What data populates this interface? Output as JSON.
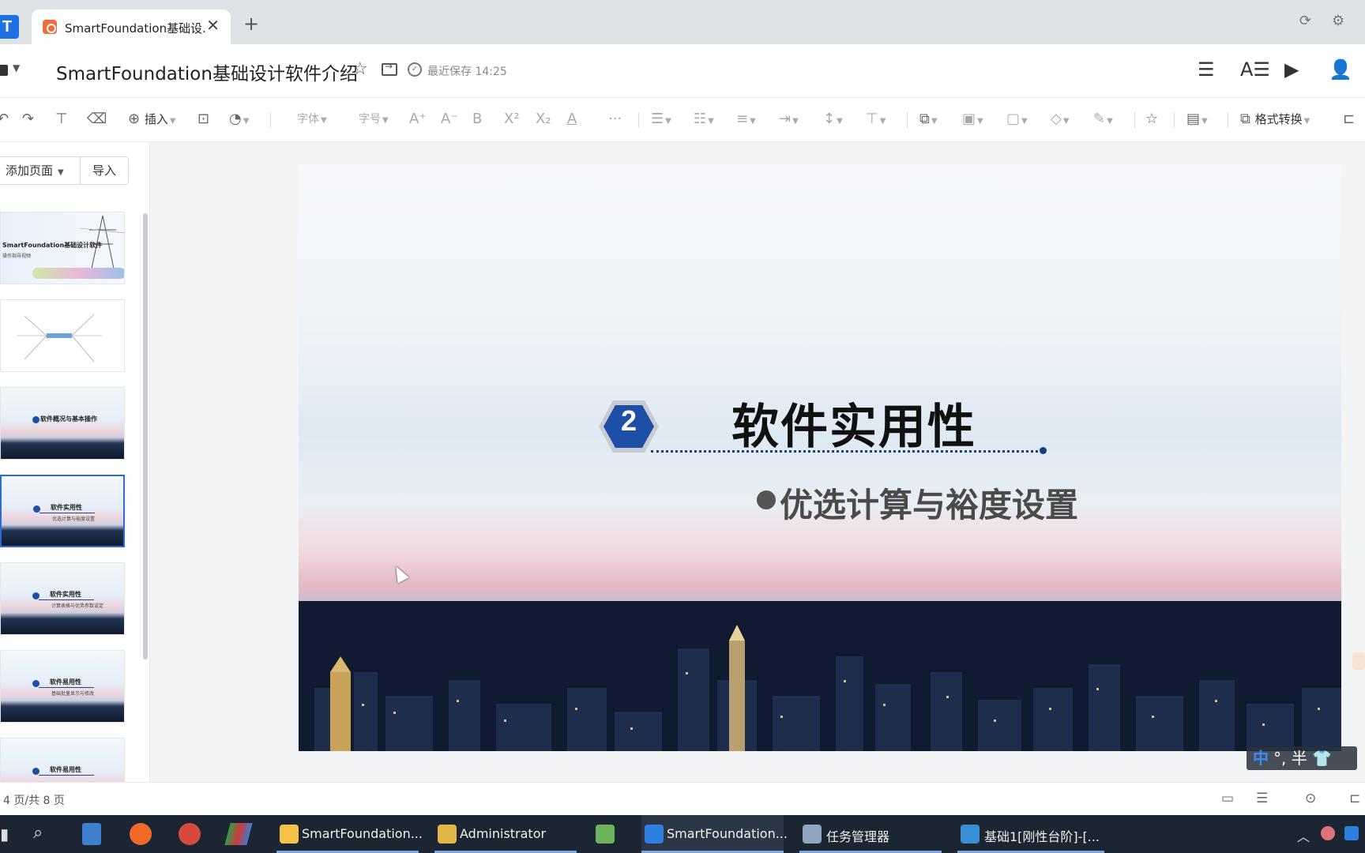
{
  "tabbar": {
    "tab_title": "SmartFoundation基础设...",
    "new_tab": "+",
    "close": "✕"
  },
  "titlebar": {
    "doc_title": "SmartFoundation基础设计软件介绍",
    "save_status": "最近保存 14:25"
  },
  "toolbar": {
    "insert_label": "插入",
    "font_label": "字体",
    "size_label": "字号",
    "bold": "B",
    "more": "···",
    "format_convert_label": "格式转换"
  },
  "left_panel": {
    "add_page_label": "添加页面",
    "import_label": "导入",
    "thumbnails": [
      {
        "t1": "SmartFoundation基础设计软件",
        "t2": "操作指导视频"
      },
      {
        "t1": "",
        "t2": ""
      },
      {
        "t1": "软件概况与基本操作",
        "t2": ""
      },
      {
        "t1": "软件实用性",
        "t2": "优选计算与裕度设置"
      },
      {
        "t1": "软件实用性",
        "t2": "计算表格与优势参数设定"
      },
      {
        "t1": "软件易用性",
        "t2": "基础批量显示与修改"
      },
      {
        "t1": "软件易用性",
        "t2": ""
      }
    ],
    "selected_index": 3
  },
  "slide": {
    "number": "2",
    "title": "软件实用性",
    "subtitle": "优选计算与裕度设置",
    "ime_zh": "中",
    "ime_rest": "°, 半 👕"
  },
  "statusbar": {
    "page_counter": "4 页/共 8 页"
  },
  "taskbar": {
    "items": [
      {
        "label": "SmartFoundation..."
      },
      {
        "label": "Administrator"
      },
      {
        "label": ""
      },
      {
        "label": "SmartFoundation..."
      },
      {
        "label": "任务管理器"
      },
      {
        "label": "基础1[刚性台阶]-[..."
      }
    ]
  },
  "colors": {
    "accent": "#2b6bd6",
    "slide_title": "#101010",
    "taskbar": "#1c2632"
  }
}
